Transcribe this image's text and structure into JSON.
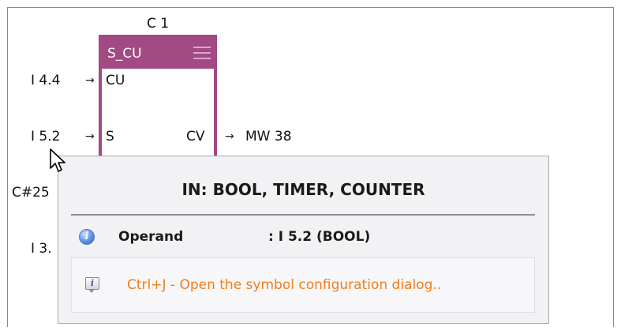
{
  "block": {
    "instance_name": "C 1",
    "type_name": "S_CU",
    "colors": {
      "header": "#a24a84"
    }
  },
  "pins": {
    "cu": {
      "operand": "I 4.4",
      "label": "CU"
    },
    "s": {
      "operand": "I 5.2",
      "label": "S"
    },
    "cv": {
      "label": "CV",
      "operand": "MW 38"
    },
    "pv_operand_partial": "C#25",
    "r_operand_partial": "I 3."
  },
  "tooltip": {
    "title": "IN: BOOL, TIMER, COUNTER",
    "operand_label": "Operand",
    "operand_value": ": I 5.2 (BOOL)",
    "hint_text": "Ctrl+J - Open the symbol configuration dialog..",
    "colors": {
      "hint_text": "#f07c1a"
    }
  },
  "icons": {
    "menu": "hamburger-icon",
    "info": "info-icon",
    "hint": "hint-icon",
    "cursor": "mouse-pointer-icon"
  }
}
